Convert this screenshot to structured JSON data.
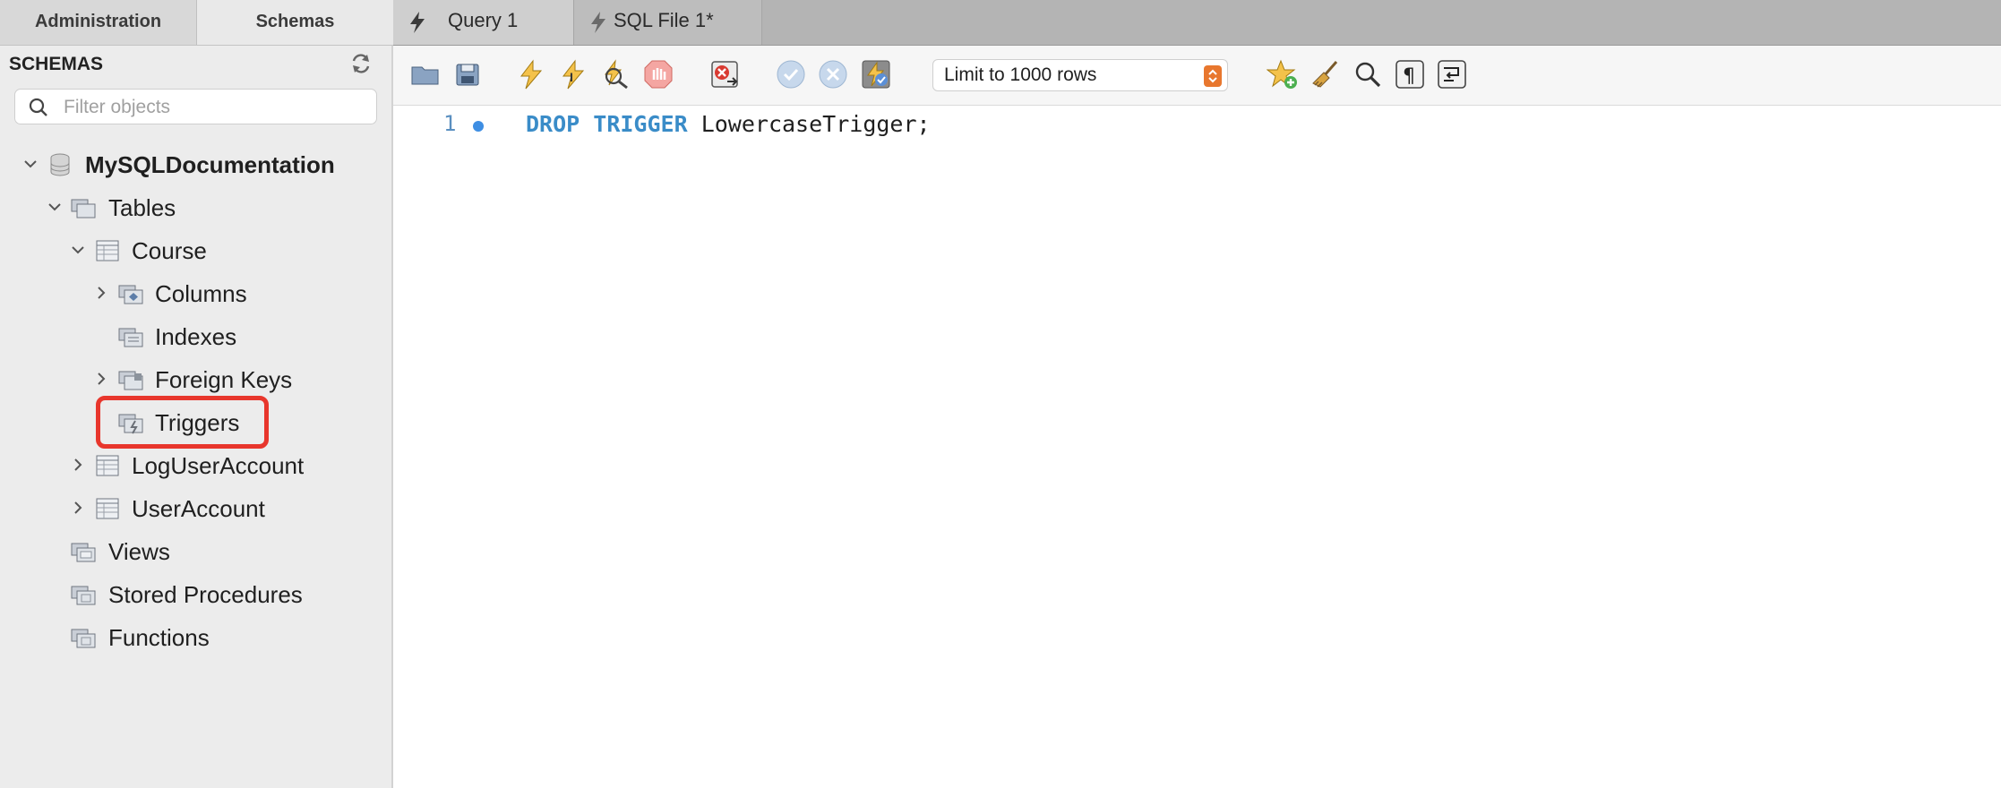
{
  "sidebar": {
    "tabs": {
      "administration": "Administration",
      "schemas": "Schemas"
    },
    "title": "SCHEMAS",
    "filter_placeholder": "Filter objects",
    "tree": {
      "schema": "MySQLDocumentation",
      "tables": "Tables",
      "course": "Course",
      "columns": "Columns",
      "indexes": "Indexes",
      "foreign_keys": "Foreign Keys",
      "triggers": "Triggers",
      "log_user_account": "LogUserAccount",
      "user_account": "UserAccount",
      "views": "Views",
      "stored_procedures": "Stored Procedures",
      "functions": "Functions"
    },
    "highlighted_item": "Triggers"
  },
  "tabs": [
    {
      "label": "Query 1",
      "active": true
    },
    {
      "label": "SQL File 1*",
      "active": false
    }
  ],
  "toolbar": {
    "icons": [
      "open-folder-icon",
      "save-icon",
      "execute-icon",
      "execute-current-icon",
      "explain-icon",
      "stop-icon",
      "toggle-error-icon",
      "commit-icon",
      "rollback-icon",
      "autocommit-icon",
      "add-snippet-icon",
      "beautify-icon",
      "find-icon",
      "invisible-chars-icon",
      "wrap-lines-icon"
    ],
    "limit_label": "Limit to 1000 rows"
  },
  "editor": {
    "line_number": "1",
    "keyword1": "DROP",
    "keyword2": "TRIGGER",
    "identifier": "LowercaseTrigger;"
  },
  "colors": {
    "keyword": "#3a8cc8",
    "highlight": "#e8362c",
    "limit_arrows": "#e8772e"
  }
}
